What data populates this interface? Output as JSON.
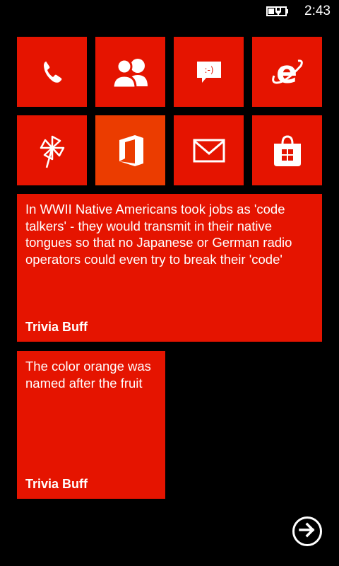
{
  "status_bar": {
    "time": "2:43",
    "battery_icon": "battery-charging-icon"
  },
  "colors": {
    "accent": "#e51400",
    "office_tile": "#eb3c00",
    "background": "#000000"
  },
  "tiles": {
    "phone": {
      "icon": "phone-icon"
    },
    "people": {
      "icon": "people-icon"
    },
    "messaging": {
      "icon": "messaging-icon",
      "glyph": ":-)"
    },
    "internet_explorer": {
      "icon": "internet-explorer-icon",
      "glyph": "e"
    },
    "photos": {
      "icon": "pinwheel-icon"
    },
    "office": {
      "icon": "office-icon"
    },
    "mail": {
      "icon": "mail-icon"
    },
    "store": {
      "icon": "store-icon"
    },
    "trivia_wide": {
      "text": "In WWII Native Americans took jobs as 'code talkers' - they would transmit in their native tongues so that no Japanese or German radio operators could even try to break their 'code'",
      "title": "Trivia Buff"
    },
    "trivia_medium": {
      "text": "The color orange was named after the fruit",
      "title": "Trivia Buff"
    }
  },
  "navigation": {
    "next_icon": "arrow-right-circle-icon"
  }
}
